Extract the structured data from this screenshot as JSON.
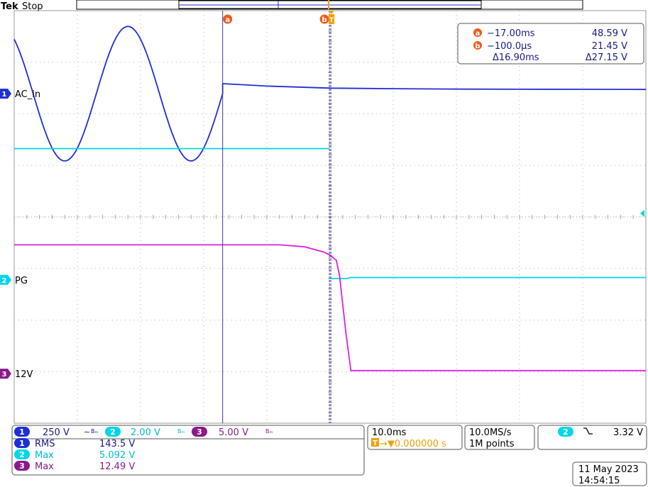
{
  "header": {
    "brand": "Tek",
    "status": "Stop"
  },
  "colors": {
    "ch1": "#1f2fd6",
    "ch2": "#00d7e6",
    "ch3": "#e020e0",
    "cursor_marker": "#f05a1e",
    "trigger": "#f0a000",
    "grid": "#9a9a9a",
    "cursor_line": "#3a3aa0"
  },
  "channels": {
    "ch1": {
      "number": "1",
      "label": "AC_in",
      "scale": "250 V",
      "coupling": "∼",
      "bw": "Bₘ"
    },
    "ch2": {
      "number": "2",
      "label": "PG",
      "scale": "2.00 V",
      "bw": "Bₘ"
    },
    "ch3": {
      "number": "3",
      "label": "12V",
      "scale": "5.00 V",
      "bw": "Bₘ"
    }
  },
  "cursors": {
    "a": {
      "marker": "a",
      "time": "−17.00ms",
      "value": "48.59 V"
    },
    "b": {
      "marker": "b",
      "time": "−100.0µs",
      "value": "21.45 V"
    },
    "delta_time": "Δ16.90ms",
    "delta_value": "Δ27.15 V"
  },
  "measurements": [
    {
      "channel": "1",
      "name": "RMS",
      "value": "143.5 V"
    },
    {
      "channel": "2",
      "name": "Max",
      "value": "5.092 V"
    },
    {
      "channel": "3",
      "name": "Max",
      "value": "12.49 V"
    }
  ],
  "timebase": {
    "scale": "10.0ms",
    "trigger_icon": "T",
    "position": "→▼0.000000 s"
  },
  "acquisition": {
    "rate": "10.0MS/s",
    "points": "1M points"
  },
  "trigger": {
    "channel": "2",
    "slope_icon": "falling-edge-icon",
    "slope_glyph": "⍂",
    "level": "3.32 V"
  },
  "datetime": {
    "date": "11 May 2023",
    "time": "14:54:15"
  },
  "chart_data": {
    "type": "line",
    "x_unit": "ms",
    "xlim": [
      -50,
      50
    ],
    "ylim_div": [
      -4,
      4
    ],
    "grid": true,
    "cursor_a_x_ms": -17.0,
    "cursor_b_x_ms": -0.1,
    "series": [
      {
        "name": "AC_in",
        "channel": 1,
        "offset_div": 2.39,
        "volts_per_div": 250,
        "segments": [
          {
            "kind": "sine",
            "x_start": -50,
            "x_end": -17,
            "peak_v": 326,
            "mid_v": 0,
            "period_ms": 20,
            "peak_at_ms": -32
          },
          {
            "kind": "points",
            "x": [
              -17,
              -10,
              0,
              10,
              20,
              30,
              40,
              50
            ],
            "y": [
              48.6,
              37,
              27,
              24,
              22,
              21.5,
              21,
              20.5
            ]
          }
        ]
      },
      {
        "name": "PG",
        "channel": 2,
        "offset_div": -1.22,
        "volts_per_div": 2,
        "segments": [
          {
            "kind": "points",
            "x": [
              -50,
              -0.1
            ],
            "y": [
              5.09,
              5.09
            ]
          },
          {
            "kind": "points",
            "x": [
              0,
              2.8,
              3.2,
              50
            ],
            "y": [
              0.05,
              0.05,
              0.09,
              0.09
            ]
          }
        ]
      },
      {
        "name": "12V",
        "channel": 3,
        "offset_div": -3.04,
        "volts_per_div": 5,
        "segments": [
          {
            "kind": "points",
            "x": [
              -50,
              -8,
              -4,
              -1,
              0,
              1,
              1.5,
              2.5,
              3.3,
              3.8,
              50
            ],
            "y": [
              12.49,
              12.49,
              12.3,
              11.8,
              11.5,
              11.0,
              9.5,
              4.0,
              0.3,
              0.3,
              0.3
            ]
          }
        ]
      }
    ]
  }
}
